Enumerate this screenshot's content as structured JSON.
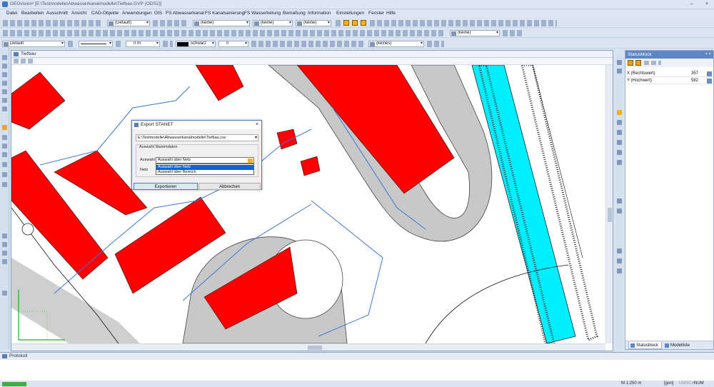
{
  "window": {
    "title": "GEOvision³  [E:\\Testmodelle\\Abwasserkanalmodelle\\Tiefbau.GVP (ODS2)]",
    "minimize": "–",
    "close": "×"
  },
  "menu": [
    "Datei",
    "Bearbeiten",
    "Ausschnitt",
    "Ansicht",
    "CAD-Objekte",
    "Anwendungen",
    "GIS",
    "FS Abwasserkanal",
    "FS Kanalsanierung",
    "FS Wasserleitung",
    "Bemaßung",
    "Information",
    "Einstellungen",
    "Fenster",
    "Hilfe"
  ],
  "toolbar1": {
    "combo_default": "(Default)",
    "combo_keine1": "(keine)",
    "combo_keine2": "(keine)",
    "combo_keine3": "(keine)"
  },
  "toolbar2": {
    "combo_keine": "(keine)"
  },
  "toolbar3": {
    "layer_default": "Default",
    "offset": "0 m",
    "color": "schwarz",
    "linewidth": "0",
    "combo_keines": "(keines)"
  },
  "map_window": {
    "title": "Tiefbau"
  },
  "statusblock": {
    "title": "Statusblock",
    "pin": "▪ ×",
    "rows": [
      {
        "label": "X (Rechtswert)",
        "value": "357"
      },
      {
        "label": "Y (Hochwert)",
        "value": "582"
      }
    ],
    "tab_statusblock": "Statusblock",
    "tab_modelliste": "Modelliste"
  },
  "protokoll": {
    "title": "Protokoll"
  },
  "statusbar": {
    "scale": "M 1:250  m",
    "unit": "[gon]",
    "umsch": "UMSCH",
    "num": "NUM"
  },
  "dialog": {
    "title": "Export STANET",
    "close": "×",
    "path": "E:\\Testmodelle\\Abwasserkanalmodelle\\Tiefbau.csv",
    "group_label": "Auswahl Stammdaten",
    "auswahl_label": "Auswahl",
    "netz_label": "Netz",
    "selected": "Auswahl über Netz",
    "options": [
      "Auswahl über Netz",
      "Auswahl über Bereich"
    ],
    "export_button": "Exportieren",
    "cancel_button": "Abbrechen"
  },
  "colors": {
    "building": "#ff0000",
    "water": "#00eeff",
    "road": "#c8c8c8",
    "pipe": "#3c78d8",
    "accent": "#5d86c4"
  }
}
